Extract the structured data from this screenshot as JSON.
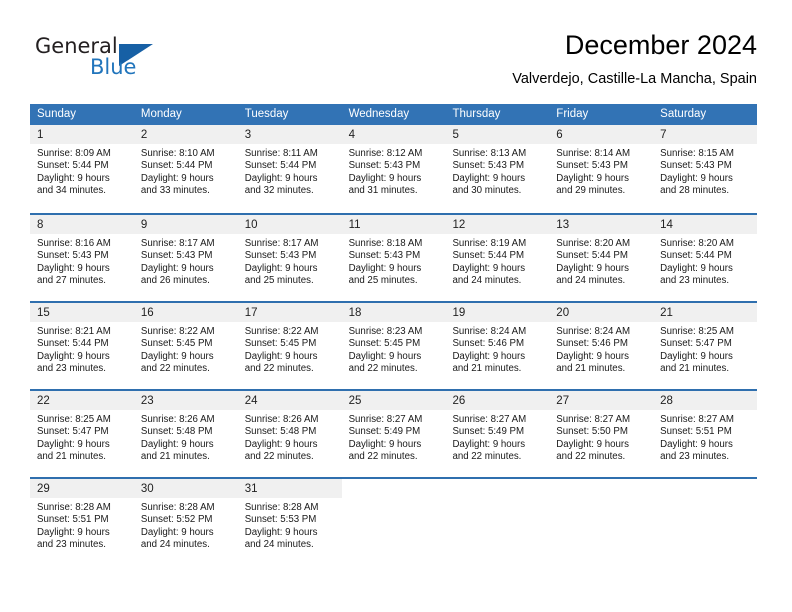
{
  "brand": {
    "name_part1": "General",
    "name_part2": "Blue",
    "logo_icon": "triangle-logo-icon",
    "accent_color": "#1760a5"
  },
  "header": {
    "title": "December 2024",
    "subtitle": "Valverdejo, Castille-La Mancha, Spain"
  },
  "calendar": {
    "header_bg": "#3273b5",
    "separator_color": "#2f6fae",
    "daynum_band_bg": "#f0f0f0",
    "weekdays": [
      "Sunday",
      "Monday",
      "Tuesday",
      "Wednesday",
      "Thursday",
      "Friday",
      "Saturday"
    ],
    "weeks": [
      [
        {
          "day": "1",
          "sunrise": "Sunrise: 8:09 AM",
          "sunset": "Sunset: 5:44 PM",
          "daylight1": "Daylight: 9 hours",
          "daylight2": "and 34 minutes."
        },
        {
          "day": "2",
          "sunrise": "Sunrise: 8:10 AM",
          "sunset": "Sunset: 5:44 PM",
          "daylight1": "Daylight: 9 hours",
          "daylight2": "and 33 minutes."
        },
        {
          "day": "3",
          "sunrise": "Sunrise: 8:11 AM",
          "sunset": "Sunset: 5:44 PM",
          "daylight1": "Daylight: 9 hours",
          "daylight2": "and 32 minutes."
        },
        {
          "day": "4",
          "sunrise": "Sunrise: 8:12 AM",
          "sunset": "Sunset: 5:43 PM",
          "daylight1": "Daylight: 9 hours",
          "daylight2": "and 31 minutes."
        },
        {
          "day": "5",
          "sunrise": "Sunrise: 8:13 AM",
          "sunset": "Sunset: 5:43 PM",
          "daylight1": "Daylight: 9 hours",
          "daylight2": "and 30 minutes."
        },
        {
          "day": "6",
          "sunrise": "Sunrise: 8:14 AM",
          "sunset": "Sunset: 5:43 PM",
          "daylight1": "Daylight: 9 hours",
          "daylight2": "and 29 minutes."
        },
        {
          "day": "7",
          "sunrise": "Sunrise: 8:15 AM",
          "sunset": "Sunset: 5:43 PM",
          "daylight1": "Daylight: 9 hours",
          "daylight2": "and 28 minutes."
        }
      ],
      [
        {
          "day": "8",
          "sunrise": "Sunrise: 8:16 AM",
          "sunset": "Sunset: 5:43 PM",
          "daylight1": "Daylight: 9 hours",
          "daylight2": "and 27 minutes."
        },
        {
          "day": "9",
          "sunrise": "Sunrise: 8:17 AM",
          "sunset": "Sunset: 5:43 PM",
          "daylight1": "Daylight: 9 hours",
          "daylight2": "and 26 minutes."
        },
        {
          "day": "10",
          "sunrise": "Sunrise: 8:17 AM",
          "sunset": "Sunset: 5:43 PM",
          "daylight1": "Daylight: 9 hours",
          "daylight2": "and 25 minutes."
        },
        {
          "day": "11",
          "sunrise": "Sunrise: 8:18 AM",
          "sunset": "Sunset: 5:43 PM",
          "daylight1": "Daylight: 9 hours",
          "daylight2": "and 25 minutes."
        },
        {
          "day": "12",
          "sunrise": "Sunrise: 8:19 AM",
          "sunset": "Sunset: 5:44 PM",
          "daylight1": "Daylight: 9 hours",
          "daylight2": "and 24 minutes."
        },
        {
          "day": "13",
          "sunrise": "Sunrise: 8:20 AM",
          "sunset": "Sunset: 5:44 PM",
          "daylight1": "Daylight: 9 hours",
          "daylight2": "and 24 minutes."
        },
        {
          "day": "14",
          "sunrise": "Sunrise: 8:20 AM",
          "sunset": "Sunset: 5:44 PM",
          "daylight1": "Daylight: 9 hours",
          "daylight2": "and 23 minutes."
        }
      ],
      [
        {
          "day": "15",
          "sunrise": "Sunrise: 8:21 AM",
          "sunset": "Sunset: 5:44 PM",
          "daylight1": "Daylight: 9 hours",
          "daylight2": "and 23 minutes."
        },
        {
          "day": "16",
          "sunrise": "Sunrise: 8:22 AM",
          "sunset": "Sunset: 5:45 PM",
          "daylight1": "Daylight: 9 hours",
          "daylight2": "and 22 minutes."
        },
        {
          "day": "17",
          "sunrise": "Sunrise: 8:22 AM",
          "sunset": "Sunset: 5:45 PM",
          "daylight1": "Daylight: 9 hours",
          "daylight2": "and 22 minutes."
        },
        {
          "day": "18",
          "sunrise": "Sunrise: 8:23 AM",
          "sunset": "Sunset: 5:45 PM",
          "daylight1": "Daylight: 9 hours",
          "daylight2": "and 22 minutes."
        },
        {
          "day": "19",
          "sunrise": "Sunrise: 8:24 AM",
          "sunset": "Sunset: 5:46 PM",
          "daylight1": "Daylight: 9 hours",
          "daylight2": "and 21 minutes."
        },
        {
          "day": "20",
          "sunrise": "Sunrise: 8:24 AM",
          "sunset": "Sunset: 5:46 PM",
          "daylight1": "Daylight: 9 hours",
          "daylight2": "and 21 minutes."
        },
        {
          "day": "21",
          "sunrise": "Sunrise: 8:25 AM",
          "sunset": "Sunset: 5:47 PM",
          "daylight1": "Daylight: 9 hours",
          "daylight2": "and 21 minutes."
        }
      ],
      [
        {
          "day": "22",
          "sunrise": "Sunrise: 8:25 AM",
          "sunset": "Sunset: 5:47 PM",
          "daylight1": "Daylight: 9 hours",
          "daylight2": "and 21 minutes."
        },
        {
          "day": "23",
          "sunrise": "Sunrise: 8:26 AM",
          "sunset": "Sunset: 5:48 PM",
          "daylight1": "Daylight: 9 hours",
          "daylight2": "and 21 minutes."
        },
        {
          "day": "24",
          "sunrise": "Sunrise: 8:26 AM",
          "sunset": "Sunset: 5:48 PM",
          "daylight1": "Daylight: 9 hours",
          "daylight2": "and 22 minutes."
        },
        {
          "day": "25",
          "sunrise": "Sunrise: 8:27 AM",
          "sunset": "Sunset: 5:49 PM",
          "daylight1": "Daylight: 9 hours",
          "daylight2": "and 22 minutes."
        },
        {
          "day": "26",
          "sunrise": "Sunrise: 8:27 AM",
          "sunset": "Sunset: 5:49 PM",
          "daylight1": "Daylight: 9 hours",
          "daylight2": "and 22 minutes."
        },
        {
          "day": "27",
          "sunrise": "Sunrise: 8:27 AM",
          "sunset": "Sunset: 5:50 PM",
          "daylight1": "Daylight: 9 hours",
          "daylight2": "and 22 minutes."
        },
        {
          "day": "28",
          "sunrise": "Sunrise: 8:27 AM",
          "sunset": "Sunset: 5:51 PM",
          "daylight1": "Daylight: 9 hours",
          "daylight2": "and 23 minutes."
        }
      ],
      [
        {
          "day": "29",
          "sunrise": "Sunrise: 8:28 AM",
          "sunset": "Sunset: 5:51 PM",
          "daylight1": "Daylight: 9 hours",
          "daylight2": "and 23 minutes."
        },
        {
          "day": "30",
          "sunrise": "Sunrise: 8:28 AM",
          "sunset": "Sunset: 5:52 PM",
          "daylight1": "Daylight: 9 hours",
          "daylight2": "and 24 minutes."
        },
        {
          "day": "31",
          "sunrise": "Sunrise: 8:28 AM",
          "sunset": "Sunset: 5:53 PM",
          "daylight1": "Daylight: 9 hours",
          "daylight2": "and 24 minutes."
        },
        {
          "day": "",
          "sunrise": "",
          "sunset": "",
          "daylight1": "",
          "daylight2": ""
        },
        {
          "day": "",
          "sunrise": "",
          "sunset": "",
          "daylight1": "",
          "daylight2": ""
        },
        {
          "day": "",
          "sunrise": "",
          "sunset": "",
          "daylight1": "",
          "daylight2": ""
        },
        {
          "day": "",
          "sunrise": "",
          "sunset": "",
          "daylight1": "",
          "daylight2": ""
        }
      ]
    ]
  }
}
